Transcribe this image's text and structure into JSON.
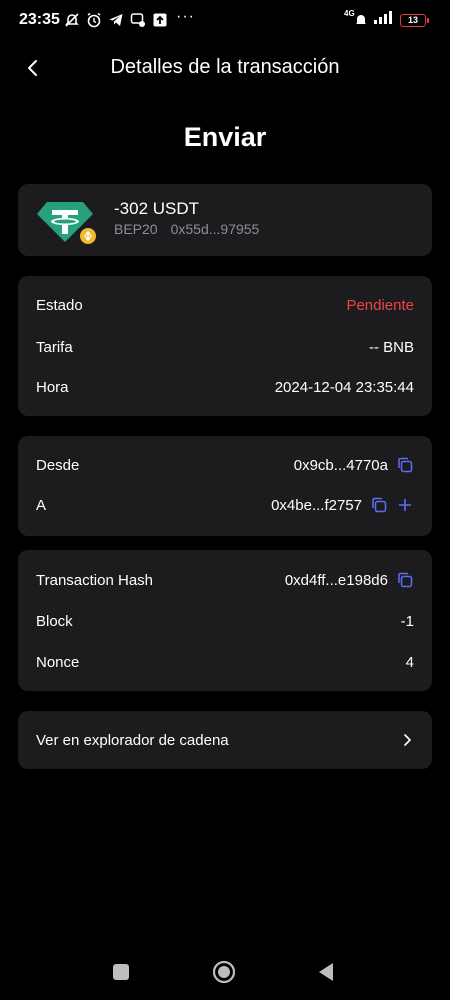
{
  "status_bar": {
    "time": "23:35",
    "network": "4G",
    "battery": "13"
  },
  "header": {
    "title": "Detalles de la transacción"
  },
  "page": {
    "title": "Enviar"
  },
  "token": {
    "amount": "-302 USDT",
    "network": "BEP20",
    "address": "0x55d...97955"
  },
  "status_card": {
    "estado_label": "Estado",
    "estado_value": "Pendiente",
    "tarifa_label": "Tarifa",
    "tarifa_value": "-- BNB",
    "hora_label": "Hora",
    "hora_value": "2024-12-04 23:35:44"
  },
  "address_card": {
    "desde_label": "Desde",
    "desde_value": "0x9cb...4770a",
    "a_label": "A",
    "a_value": "0x4be...f2757"
  },
  "hash_card": {
    "hash_label": "Transaction Hash",
    "hash_value": "0xd4ff...e198d6",
    "block_label": "Block",
    "block_value": "-1",
    "nonce_label": "Nonce",
    "nonce_value": "4"
  },
  "explorer": {
    "label": "Ver en explorador de cadena"
  },
  "colors": {
    "background": "#000000",
    "card": "#1c1c1e",
    "pending": "#ef4444",
    "accent_icon": "#5b6ef5",
    "tether": "#26a17b",
    "bnb_badge": "#f3ba2f"
  }
}
